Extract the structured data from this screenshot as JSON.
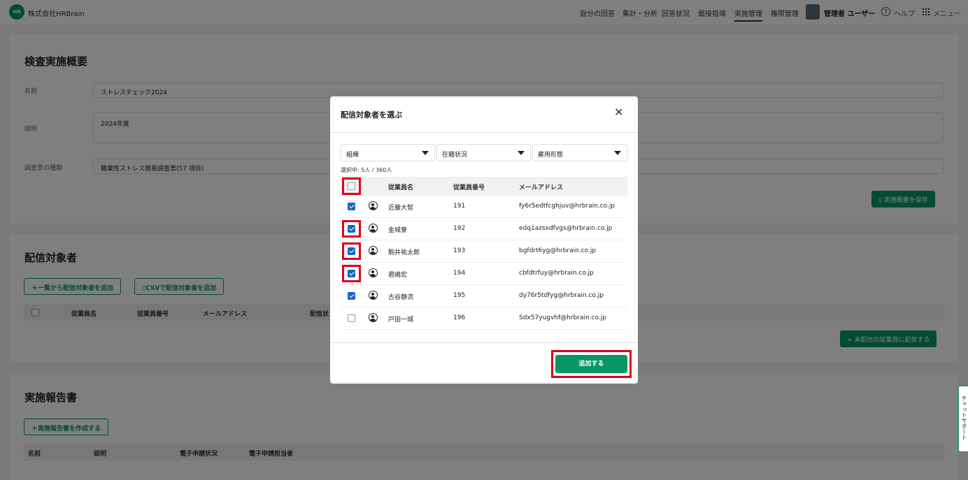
{
  "header": {
    "logo_text": "HR",
    "company": "株式会社HRBrain",
    "nav": [
      "自分の回答",
      "集計・分析",
      "回答状況",
      "面接指導",
      "実施管理",
      "権限管理"
    ],
    "active_nav": "実施管理",
    "user": "管理者 ユーザー",
    "help": "ヘルプ",
    "menu": "メニュー"
  },
  "overview": {
    "title": "検査実施概要",
    "name_label": "名前",
    "name_value": "ストレスチェック2024",
    "desc_label": "説明",
    "desc_value": "2024年度",
    "type_label": "調査票の種類",
    "type_value": "職業性ストレス簡易調査票(57 項目)",
    "save_button": "実施概要を保存"
  },
  "targets": {
    "title": "配信対象者",
    "add_from_list": "一覧から配信対象者を追加",
    "add_csv": "CSVで配信対象者を追加",
    "columns": [
      "従業員名",
      "従業員番号",
      "メールアドレス",
      "配信状"
    ],
    "send_button": "未配信の従業員に配信する"
  },
  "report": {
    "title": "実施報告書",
    "create_button": "実施報告書を作成する",
    "columns": [
      "名前",
      "説明",
      "電子申請状況",
      "電子申請担当者"
    ]
  },
  "modal": {
    "title": "配信対象者を選ぶ",
    "filters": [
      "組織",
      "在籍状況",
      "雇用形態"
    ],
    "selected_count": "選択中: 5人 / 360人",
    "columns": {
      "name": "従業員名",
      "number": "従業員番号",
      "email": "メールアドレス"
    },
    "rows": [
      {
        "checked": true,
        "name": "近藤大智",
        "number": "191",
        "email": "fy6r5edtfcghjuv@hrbrain.co.jp"
      },
      {
        "checked": true,
        "name": "金城寮",
        "number": "192",
        "email": "edq1azsxdfvgs@hrbrain.co.jp"
      },
      {
        "checked": true,
        "name": "駒井祐太郎",
        "number": "193",
        "email": "bgfdrt6yg@hrbrain.co.jp"
      },
      {
        "checked": true,
        "name": "君嶋宏",
        "number": "194",
        "email": "cbfdtrfuy@hrbrain.co.jp"
      },
      {
        "checked": true,
        "name": "古谷静流",
        "number": "195",
        "email": "dy76r5tdfyg@hrbrain.co.jp"
      },
      {
        "checked": false,
        "name": "戸田一城",
        "number": "196",
        "email": "Sdx57yugvhf@hrbrain.co.jp"
      }
    ],
    "add_button": "追加する",
    "highlight_color": "#e0001b"
  },
  "chat_support": "チャットサポート",
  "colors": {
    "brand_green": "#079664",
    "checkbox_blue": "#1565c0"
  }
}
